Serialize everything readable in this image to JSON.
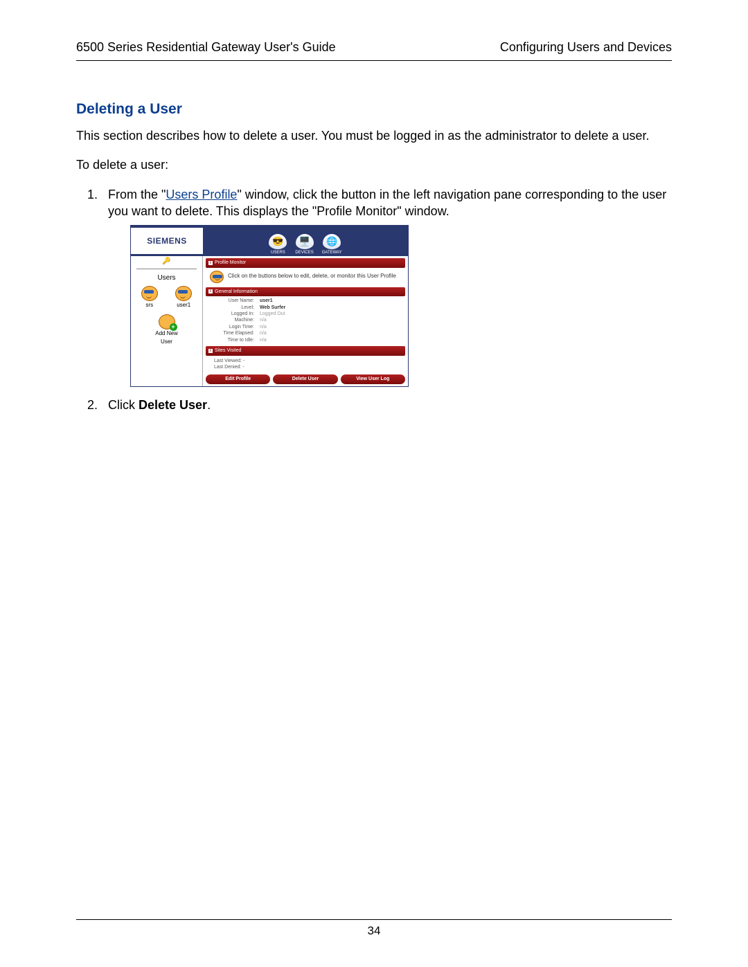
{
  "header": {
    "left": "6500 Series Residential Gateway User's Guide",
    "right": "Configuring Users and Devices"
  },
  "section_title": "Deleting a User",
  "intro": "This section describes how to delete a user. You must be logged in as the administrator to delete a user.",
  "lead": "To delete a user:",
  "steps": {
    "s1_pre": "From the \"",
    "s1_link": "Users Profile",
    "s1_post": "\" window, click the button in the left navigation pane corresponding to the user you want to delete. This displays the \"Profile Monitor\" window.",
    "s2_pre": "Click ",
    "s2_bold": "Delete User",
    "s2_post": "."
  },
  "screenshot": {
    "logo": "SIEMENS",
    "tabs": {
      "users": "USERS",
      "devices": "DEVICES",
      "gateway": "GATEWAY"
    },
    "sidebar": {
      "heading": "Users",
      "user_a": "srs",
      "user_b": "user1",
      "add_new": "Add New",
      "add_user": "User"
    },
    "main": {
      "profile_monitor": "Profile Monitor",
      "desc_line": "Click on the buttons below to edit, delete, or monitor this User Profile",
      "general_info": "General Information",
      "info": {
        "user_name_l": "User Name:",
        "user_name_v": "user1",
        "level_l": "Level:",
        "level_v": "Web Surfer",
        "logged_in_l": "Logged In:",
        "logged_in_v": "Logged Out",
        "machine_l": "Machine:",
        "machine_v": "n/a",
        "login_time_l": "Login Time:",
        "login_time_v": "n/a",
        "time_elapsed_l": "Time Elapsed:",
        "time_elapsed_v": "n/a",
        "time_to_idle_l": "Time to Idle:",
        "time_to_idle_v": "n/a"
      },
      "sites_visited": "Sites Visited",
      "last_viewed": "Last Viewed:  -",
      "last_denied": "Last Denied:  -",
      "buttons": {
        "edit": "Edit Profile",
        "delete": "Delete User",
        "view": "View User Log"
      }
    }
  },
  "page_number": "34"
}
